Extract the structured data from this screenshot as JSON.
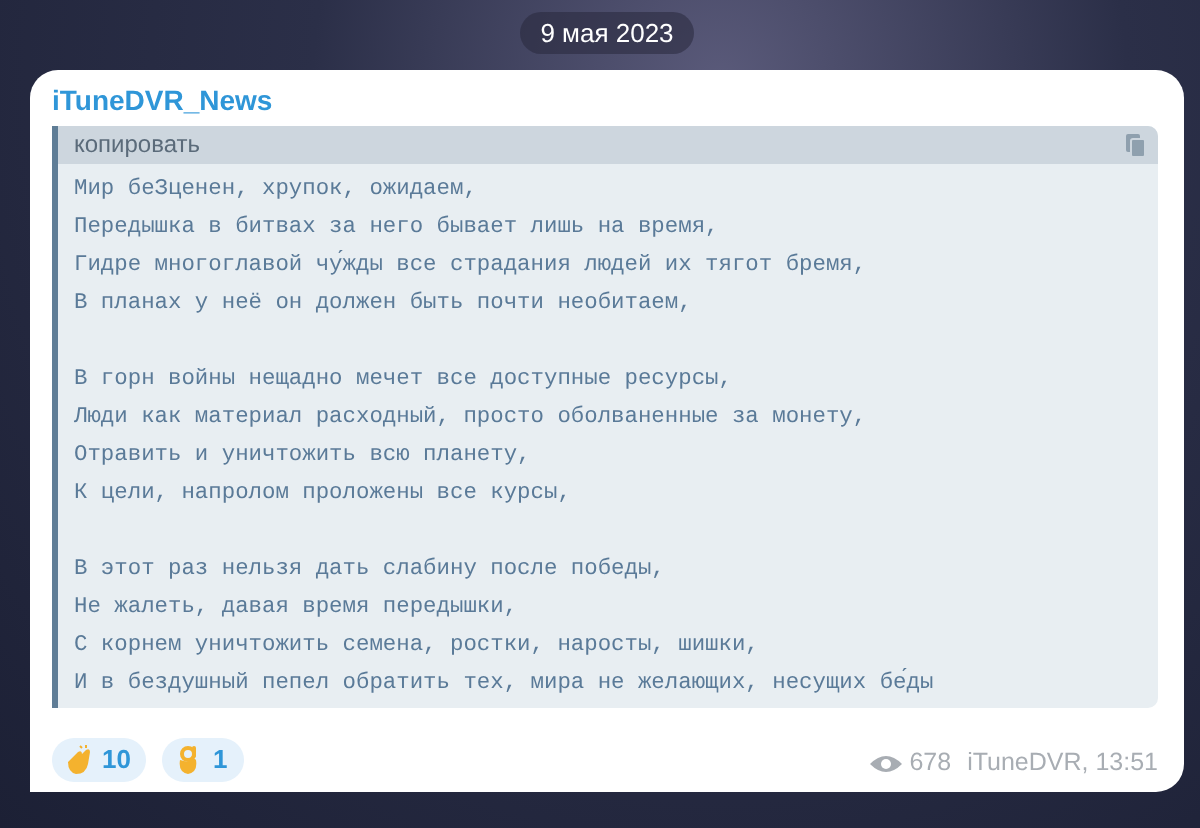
{
  "date": "9 мая 2023",
  "message": {
    "channel": "iTuneDVR_News",
    "code_block": {
      "header": "копировать",
      "stanzas": [
        [
          "Мир беЗценен, хрупок, ожидаем,",
          "Передышка в битвах за него бывает лишь на время,",
          "Гидре многоглавой чу́жды все страдания людей их тягот бремя,",
          "В планах у неё он должен быть почти необитаем,"
        ],
        [
          "В горн войны нещадно мечет все доступные ресурсы,",
          "Люди как материал расходный, просто оболваненные за монету,",
          "Отравить и уничтожить всю планету,",
          "К цели, напролом проложены все курсы,"
        ],
        [
          "В этот раз нельзя дать слабину после победы,",
          "Не жалеть, давая время передышки,",
          "С корнем уничтожить семена, ростки, наросты, шишки,",
          "И в бездушный пепел обратить тех, мира не желающих, несущих бе́ды"
        ]
      ]
    },
    "reactions": [
      {
        "kind": "clap",
        "count": "10"
      },
      {
        "kind": "ok",
        "count": "1"
      }
    ],
    "views": "678",
    "signature": "iTuneDVR, 13:51"
  }
}
